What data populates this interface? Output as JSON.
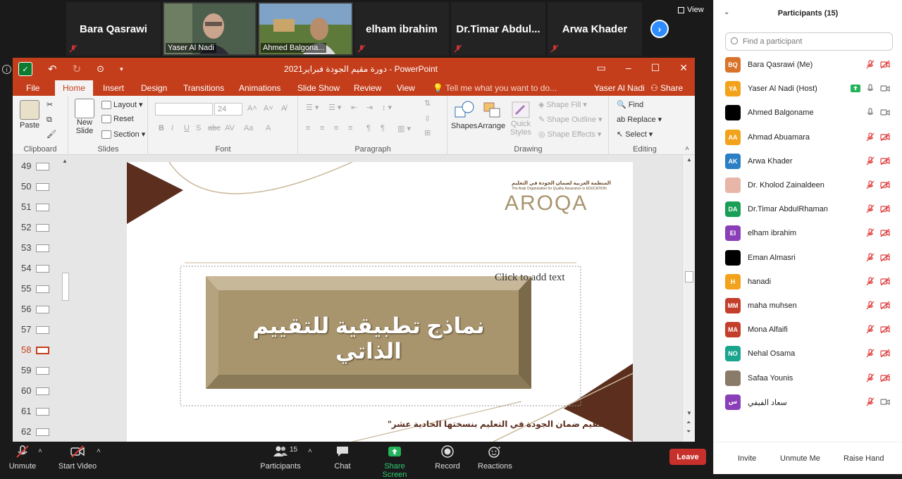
{
  "video_strip": {
    "tiles": [
      {
        "name": "Bara Qasrawi",
        "muted": true
      },
      {
        "name": "Yaser Al Nadi",
        "video": true
      },
      {
        "name": "Ahmed Balgona...",
        "video": true
      },
      {
        "name": "elham ibrahim",
        "muted": true
      },
      {
        "name": "Dr.Timar  Abdul...",
        "muted": true
      },
      {
        "name": "Arwa Khader",
        "muted": true
      }
    ],
    "view_label": "View"
  },
  "powerpoint": {
    "title": "دورة مقيم الجودة  فبراير2021  -  PowerPoint",
    "tell_me": "Tell me what you want to do...",
    "user": "Yaser Al Nadi",
    "share": "Share",
    "tabs": [
      "File",
      "Home",
      "Insert",
      "Design",
      "Transitions",
      "Animations",
      "Slide Show",
      "Review",
      "View"
    ],
    "active_tab": "Home",
    "ribbon": {
      "clipboard": {
        "label": "Clipboard",
        "paste": "Paste"
      },
      "slides": {
        "label": "Slides",
        "new_slide": "New",
        "new_slide2": "Slide",
        "layout": "Layout",
        "reset": "Reset",
        "section": "Section"
      },
      "font": {
        "label": "Font",
        "size": "24"
      },
      "paragraph": {
        "label": "Paragraph"
      },
      "drawing": {
        "label": "Drawing",
        "shapes": "Shapes",
        "arrange": "Arrange",
        "quick_styles": "Quick",
        "quick_styles2": "Styles",
        "shape_fill": "Shape Fill",
        "shape_outline": "Shape Outline",
        "shape_effects": "Shape Effects"
      },
      "editing": {
        "label": "Editing",
        "find": "Find",
        "replace": "Replace",
        "select": "Select"
      }
    },
    "slide_numbers": [
      "49",
      "50",
      "51",
      "52",
      "53",
      "54",
      "55",
      "56",
      "57",
      "58",
      "59",
      "60",
      "61",
      "62"
    ],
    "selected_slide": "58",
    "slide": {
      "org_arabic": "المنظمة العربية لضمان الجودة في التعليم",
      "org_english": "The Arab Organization for Quality Assurance in EDUCATION",
      "logo": "AROQA",
      "placeholder": "Click to add text",
      "main_title": "نماذج تطبيقية للتقييم الذاتي",
      "footer": "\"مقيم ضمان الجودة في التعليم بنسختها الحادية عشر\"",
      "colors": {
        "brown": "#5c2e1e",
        "gold": "#a8956e",
        "frame": "#c8b89a"
      }
    }
  },
  "zoom_bar": {
    "unmute": "Unmute",
    "start_video": "Start Video",
    "participants": "Participants",
    "participants_count": "15",
    "chat": "Chat",
    "share_screen": "Share Screen",
    "record": "Record",
    "reactions": "Reactions",
    "leave": "Leave"
  },
  "participants_panel": {
    "title": "Participants (15)",
    "search_placeholder": "Find a participant",
    "participants": [
      {
        "initials": "BQ",
        "name": "Bara Qasrawi (Me)",
        "color": "#d9732b",
        "status": "muted"
      },
      {
        "initials": "YA",
        "name": "Yaser Al Nadi (Host)",
        "color": "#f2a31b",
        "status": "live"
      },
      {
        "initials": "",
        "name": "Ahmed Balgoname",
        "color": "#000000",
        "status": "mic"
      },
      {
        "initials": "AA",
        "name": "Ahmad Abuamara",
        "color": "#f2a31b",
        "status": "muted"
      },
      {
        "initials": "AK",
        "name": "Arwa Khader",
        "color": "#2c7fc4",
        "status": "muted"
      },
      {
        "initials": "",
        "name": "Dr. Kholod Zainaldeen",
        "color": "#e8b6a8",
        "status": "muted"
      },
      {
        "initials": "DA",
        "name": "Dr.Timar AbdulRhaman",
        "color": "#1a9e57",
        "status": "muted"
      },
      {
        "initials": "EI",
        "name": "elham ibrahim",
        "color": "#8a3fb8",
        "status": "muted"
      },
      {
        "initials": "",
        "name": "Eman Almasri",
        "color": "#000000",
        "status": "muted"
      },
      {
        "initials": "H",
        "name": "hanadi",
        "color": "#f2a31b",
        "status": "muted"
      },
      {
        "initials": "MM",
        "name": "maha muhsen",
        "color": "#c43e2c",
        "status": "muted"
      },
      {
        "initials": "MA",
        "name": "Mona Alfaifi",
        "color": "#c43e2c",
        "status": "muted"
      },
      {
        "initials": "NO",
        "name": "Nehal Osama",
        "color": "#1aa58f",
        "status": "muted"
      },
      {
        "initials": "",
        "name": "Safaa Younis",
        "color": "#8a7a6a",
        "status": "muted"
      },
      {
        "initials": "س",
        "name": "سعاد الفيفي",
        "color": "#8a3fb8",
        "status": "mic-muted"
      }
    ],
    "invite": "Invite",
    "unmute_me": "Unmute Me",
    "raise_hand": "Raise Hand"
  }
}
